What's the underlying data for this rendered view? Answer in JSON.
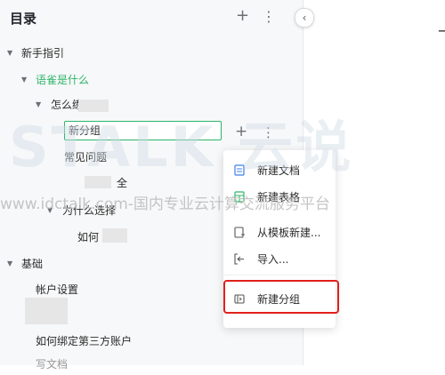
{
  "header": {
    "title": "目录",
    "add_label": "+",
    "more_label": "⋮",
    "collapse_label": "‹"
  },
  "tree": [
    {
      "label": "新手指引"
    },
    {
      "label": "语雀是什么"
    },
    {
      "label": "怎么练"
    },
    {
      "label": "常见问题"
    },
    {
      "label": "全"
    },
    {
      "label": "为什么选择"
    },
    {
      "label": "如何"
    },
    {
      "label": "基础"
    },
    {
      "label": "帐户设置"
    },
    {
      "label": "如何绑定第三方账户"
    },
    {
      "label": "写文档"
    }
  ],
  "edit": {
    "value": "新分组"
  },
  "menu": {
    "items": [
      {
        "label": "新建文档"
      },
      {
        "label": "新建表格"
      },
      {
        "label": "从模板新建..."
      },
      {
        "label": "导入..."
      },
      {
        "label": "新建分组"
      }
    ]
  },
  "watermark": {
    "brand": "STALK 云说",
    "text": "www.idctalk.com-国内专业云计算交流服务平台"
  },
  "colors": {
    "accent": "#2fb56a",
    "highlight": "#e0201b",
    "sidebar_bg": "#f7f8f9"
  },
  "icons": [
    "plus-icon",
    "more-icon",
    "chevron-left-icon",
    "caret-down-icon",
    "doc-icon",
    "sheet-icon",
    "template-icon",
    "import-icon",
    "group-icon"
  ]
}
